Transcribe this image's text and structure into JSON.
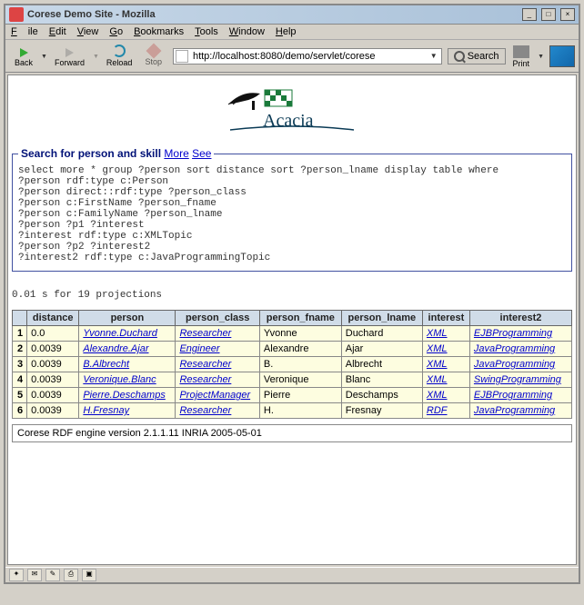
{
  "window": {
    "title": "Corese Demo Site - Mozilla"
  },
  "menus": {
    "file": "File",
    "edit": "Edit",
    "view": "View",
    "go": "Go",
    "bookmarks": "Bookmarks",
    "tools": "Tools",
    "window": "Window",
    "help": "Help"
  },
  "toolbar": {
    "back": "Back",
    "forward": "Forward",
    "reload": "Reload",
    "stop": "Stop",
    "search": "Search",
    "print": "Print"
  },
  "url": {
    "value": "http://localhost:8080/demo/servlet/corese"
  },
  "logo_text": "Acacia",
  "fieldset": {
    "legend_text": "Search for person and skill",
    "more": "More",
    "see": "See"
  },
  "query": "select more * group ?person sort distance sort ?person_lname display table where\n?person rdf:type c:Person\n?person direct::rdf:type ?person_class\n?person c:FirstName ?person_fname\n?person c:FamilyName ?person_lname\n?person ?p1 ?interest\n?interest rdf:type c:XMLTopic\n?person ?p2 ?interest2\n?interest2 rdf:type c:JavaProgrammingTopic",
  "timing": "0.01 s for 19 projections",
  "table": {
    "headers": [
      "",
      "distance",
      "person",
      "person_class",
      "person_fname",
      "person_lname",
      "interest",
      "interest2"
    ],
    "rows": [
      {
        "n": "1",
        "distance": "0.0",
        "person": "Yvonne.Duchard",
        "person_class": "Researcher",
        "fname": "Yvonne",
        "lname": "Duchard",
        "interest": "XML",
        "interest2": "EJBProgramming"
      },
      {
        "n": "2",
        "distance": "0.0039",
        "person": "Alexandre.Ajar",
        "person_class": "Engineer",
        "fname": "Alexandre",
        "lname": "Ajar",
        "interest": "XML",
        "interest2": "JavaProgramming"
      },
      {
        "n": "3",
        "distance": "0.0039",
        "person": "B.Albrecht",
        "person_class": "Researcher",
        "fname": "B.",
        "lname": "Albrecht",
        "interest": "XML",
        "interest2": "JavaProgramming"
      },
      {
        "n": "4",
        "distance": "0.0039",
        "person": "Veronique.Blanc",
        "person_class": "Researcher",
        "fname": "Veronique",
        "lname": "Blanc",
        "interest": "XML",
        "interest2": "SwingProgramming"
      },
      {
        "n": "5",
        "distance": "0.0039",
        "person": "Pierre.Deschamps",
        "person_class": "ProjectManager",
        "fname": "Pierre",
        "lname": "Deschamps",
        "interest": "XML",
        "interest2": "EJBProgramming"
      },
      {
        "n": "6",
        "distance": "0.0039",
        "person": "H.Fresnay",
        "person_class": "Researcher",
        "fname": "H.",
        "lname": "Fresnay",
        "interest": "RDF",
        "interest2": "JavaProgramming"
      }
    ]
  },
  "footer": "Corese RDF engine version 2.1.1.11 INRIA 2005-05-01"
}
